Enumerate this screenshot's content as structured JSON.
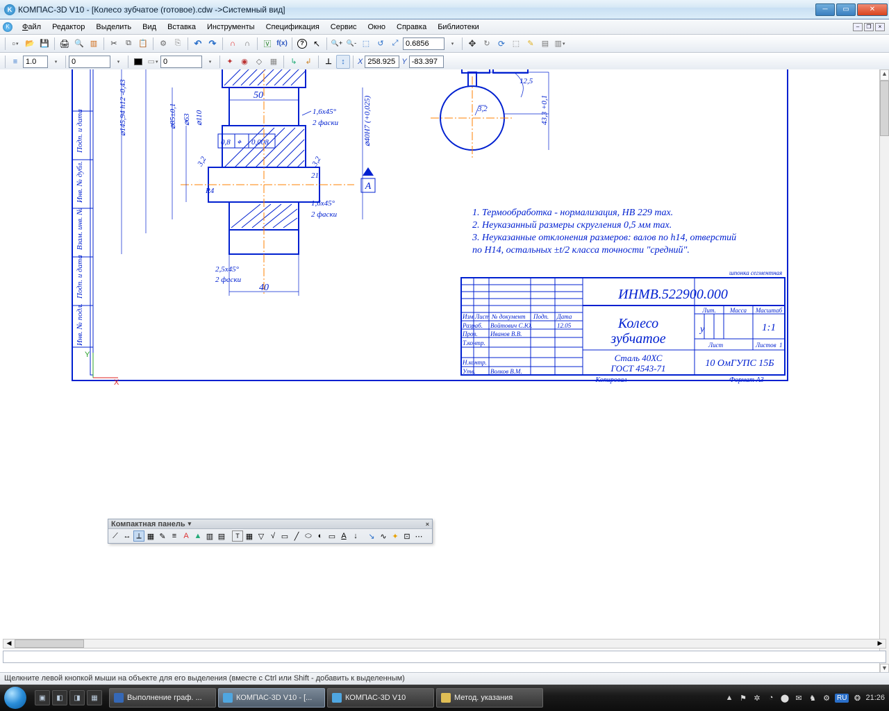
{
  "window": {
    "title": "КОМПАС-3D V10 - [Колесо зубчатое (готовое).cdw ->Системный вид]",
    "icon_letter": "K"
  },
  "menu": {
    "items": [
      "Файл",
      "Редактор",
      "Выделить",
      "Вид",
      "Вставка",
      "Инструменты",
      "Спецификация",
      "Сервис",
      "Окно",
      "Справка",
      "Библиотеки"
    ]
  },
  "toolbar_state": {
    "zoom_value": "0.6856",
    "coord_x": "258.925",
    "coord_y": "-83.397",
    "lineweight": "1.0",
    "style1": "0",
    "style2": "0"
  },
  "coord_label": {
    "x": "X",
    "y": "Y"
  },
  "float_panel": {
    "title": "Компактная панель"
  },
  "drawing": {
    "notes": [
      "1. Термообработка - нормализация, HB 229 max.",
      "2. Неуказанный размеры скругления 0,5 мм max.",
      "3. Неуказанные отклонения размеров: валов по h14, отверстий",
      "   по H14, остальных ±t/2 класса точности \"средний\"."
    ],
    "small_label_shponka": "шпонка сегментная",
    "dims": {
      "d50": "50",
      "d40": "40",
      "d63": "⌀63",
      "d110": "⌀110",
      "d145": "⌀145,94 h12 -0,43",
      "d85": "⌀85±0,1",
      "d40H7": "⌀40H7 (+0,025)",
      "ch16": "1,6x45°",
      "faski2": "2 фаски",
      "ch25": "2,5x45°",
      "r4": "R4",
      "d3_2a": "3,2",
      "d3_2b": "3,2",
      "d21": "21",
      "tolbox": "0,008",
      "tol08": "0,8",
      "d12_5": "12,5",
      "d43_3": "43,3 +0,1",
      "d3_2c": "3,2",
      "arrowA": "А"
    },
    "titleblock": {
      "code": "ИНМВ.522900.000",
      "name1": "Колесо",
      "name2": "зубчатое",
      "material1": "Сталь 40ХС",
      "material2": "ГОСТ 4543-71",
      "org": "10 ОмГУПС 15Б",
      "scale": "1:1",
      "lit": "у",
      "listov": "1",
      "kopiroval": "Копировал",
      "format": "Формат     А3",
      "rows": {
        "izm": "Изм",
        "list": "Лист",
        "ndokum": "№ документ",
        "podp": "Подп.",
        "data": "Дата",
        "razrab": "Разраб.",
        "razrab_n": "Войтович С.Ю.",
        "razrab_d": "12.05",
        "prov": "Пров.",
        "prov_n": "Иванов В.В.",
        "tkontr": "Т.контр.",
        "nkontr": "Н.контр.",
        "utv": "Утв.",
        "utv_n": "Волков В.М."
      },
      "hdr": {
        "lit": "Лит.",
        "massa": "Масса",
        "masshtab": "Масштаб",
        "list": "Лист",
        "listov": "Листов"
      }
    },
    "leftcol": {
      "a": "Подп. и дата",
      "b": "Инв. № дубл.",
      "c": "Взам. инв. №",
      "d": "Подп. и дата",
      "e": "Инв. № подл."
    }
  },
  "status": {
    "hint": "Щелкните левой кнопкой мыши на объекте для его выделения (вместе с Ctrl или Shift - добавить к выделенным)"
  },
  "taskbar": {
    "items": [
      {
        "label": "Выполнение граф. ...",
        "active": false
      },
      {
        "label": "КОМПАС-3D V10 - [...",
        "active": true
      },
      {
        "label": "КОМПАС-3D V10",
        "active": false
      },
      {
        "label": "Метод. указания",
        "active": false
      }
    ],
    "lang": "RU",
    "clock": "21:26"
  }
}
